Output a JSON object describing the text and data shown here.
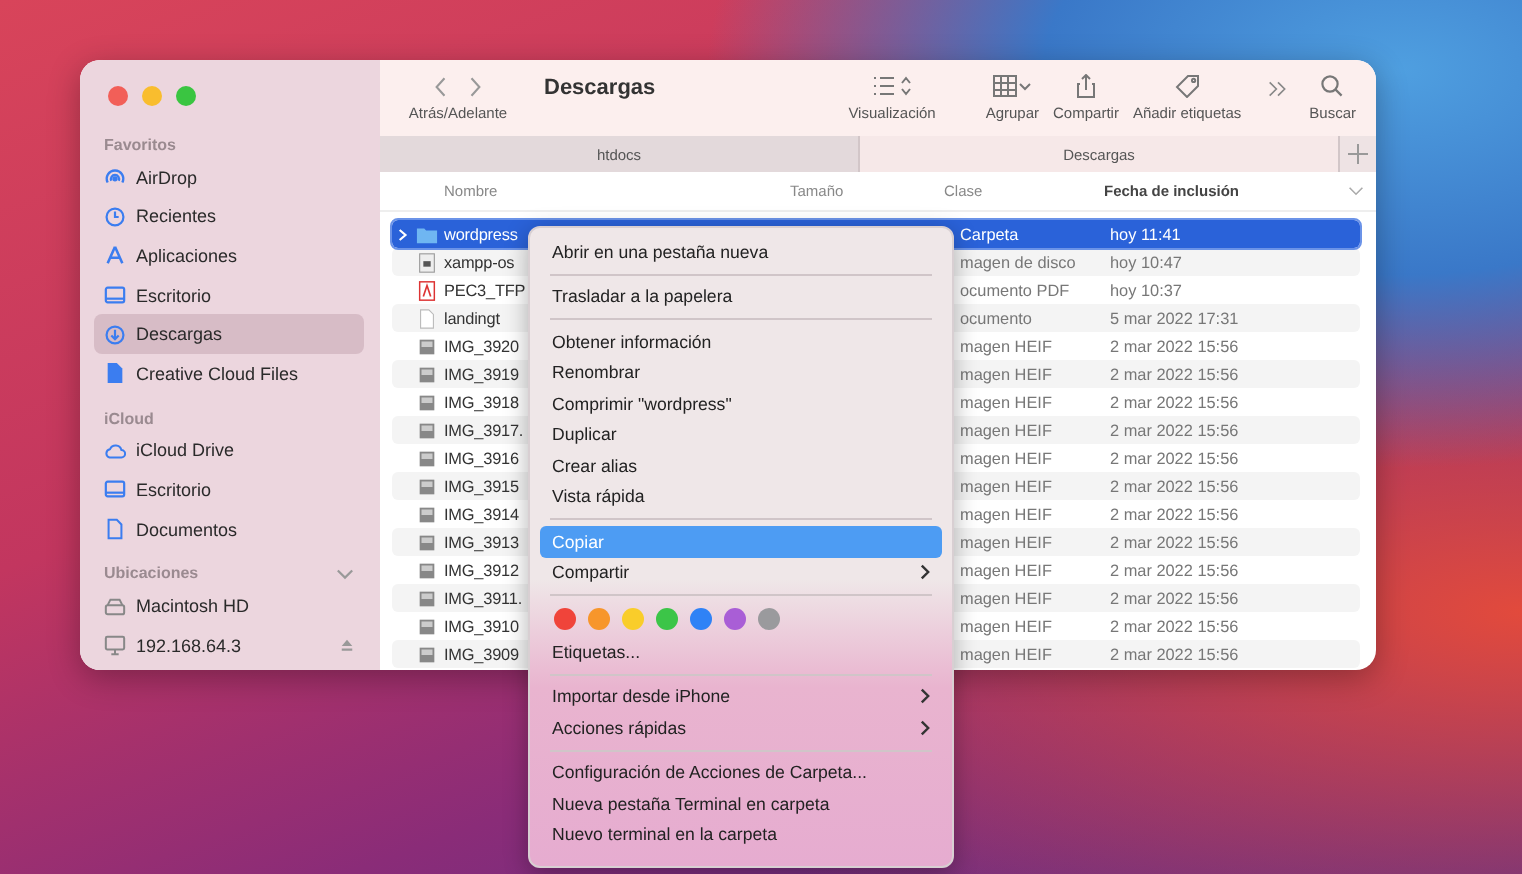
{
  "window": {
    "title": "Descargas",
    "nav_label": "Atrás/Adelante"
  },
  "toolbar": [
    {
      "kind": "view",
      "label": "Visualización"
    },
    {
      "kind": "group",
      "label": "Agrupar"
    },
    {
      "kind": "share",
      "label": "Compartir"
    },
    {
      "kind": "tag",
      "label": "Añadir etiquetas"
    },
    {
      "kind": "search",
      "label": "Buscar"
    }
  ],
  "sidebar": [
    {
      "heading": "Favoritos",
      "items": [
        {
          "label": "AirDrop",
          "selected": false
        },
        {
          "label": "Recientes",
          "selected": false
        },
        {
          "label": "Aplicaciones",
          "selected": false
        },
        {
          "label": "Escritorio",
          "selected": false
        },
        {
          "label": "Descargas",
          "selected": true
        },
        {
          "label": "Creative Cloud Files",
          "selected": false
        }
      ]
    },
    {
      "heading": "iCloud",
      "items": [
        {
          "label": "iCloud Drive",
          "selected": false
        },
        {
          "label": "Escritorio",
          "selected": false
        },
        {
          "label": "Documentos",
          "selected": false
        }
      ]
    },
    {
      "heading": "Ubicaciones",
      "items": [
        {
          "label": "Macintosh HD",
          "selected": false,
          "eject": false
        },
        {
          "label": "192.168.64.3",
          "selected": false,
          "eject": true
        }
      ]
    }
  ],
  "tabs": [
    {
      "label": "htdocs",
      "selected": false
    },
    {
      "label": "Descargas",
      "selected": true
    }
  ],
  "table": {
    "columns": [
      {
        "label": "Nombre",
        "sorted": false
      },
      {
        "label": "Tamaño",
        "sorted": false
      },
      {
        "label": "Clase",
        "sorted": false
      },
      {
        "label": "Fecha de inclusión",
        "sorted": true
      }
    ],
    "rows": [
      {
        "kind": "folder",
        "name": "wordpress",
        "class": "Carpeta",
        "date": "hoy 11:41",
        "selected": true
      },
      {
        "kind": "disk",
        "name": "xampp-os",
        "class": "magen de disco",
        "date": "hoy 10:47",
        "selected": false
      },
      {
        "kind": "pdf",
        "name": "PEC3_TFP",
        "class": "ocumento PDF",
        "date": "hoy 10:37",
        "selected": false
      },
      {
        "kind": "doc",
        "name": "landingt",
        "class": "ocumento",
        "date": "5 mar 2022 17:31",
        "selected": false
      },
      {
        "kind": "image",
        "name": "IMG_3920",
        "class": "magen HEIF",
        "date": "2 mar 2022 15:56",
        "selected": false
      },
      {
        "kind": "image",
        "name": "IMG_3919",
        "class": "magen HEIF",
        "date": "2 mar 2022 15:56",
        "selected": false
      },
      {
        "kind": "image",
        "name": "IMG_3918",
        "class": "magen HEIF",
        "date": "2 mar 2022 15:56",
        "selected": false
      },
      {
        "kind": "image",
        "name": "IMG_3917.",
        "class": "magen HEIF",
        "date": "2 mar 2022 15:56",
        "selected": false
      },
      {
        "kind": "image",
        "name": "IMG_3916",
        "class": "magen HEIF",
        "date": "2 mar 2022 15:56",
        "selected": false
      },
      {
        "kind": "image",
        "name": "IMG_3915",
        "class": "magen HEIF",
        "date": "2 mar 2022 15:56",
        "selected": false
      },
      {
        "kind": "image",
        "name": "IMG_3914",
        "class": "magen HEIF",
        "date": "2 mar 2022 15:56",
        "selected": false
      },
      {
        "kind": "image",
        "name": "IMG_3913",
        "class": "magen HEIF",
        "date": "2 mar 2022 15:56",
        "selected": false
      },
      {
        "kind": "image",
        "name": "IMG_3912",
        "class": "magen HEIF",
        "date": "2 mar 2022 15:56",
        "selected": false
      },
      {
        "kind": "image",
        "name": "IMG_3911.",
        "class": "magen HEIF",
        "date": "2 mar 2022 15:56",
        "selected": false
      },
      {
        "kind": "image",
        "name": "IMG_3910",
        "class": "magen HEIF",
        "date": "2 mar 2022 15:56",
        "selected": false
      },
      {
        "kind": "image",
        "name": "IMG_3909",
        "class": "magen HEIF",
        "date": "2 mar 2022 15:56",
        "selected": false
      }
    ]
  },
  "context_menu": [
    {
      "kind": "item",
      "label": "Abrir en una pestaña nueva",
      "selected": false,
      "submenu": false
    },
    {
      "kind": "separator"
    },
    {
      "kind": "item",
      "label": "Trasladar a la papelera",
      "selected": false,
      "submenu": false
    },
    {
      "kind": "separator"
    },
    {
      "kind": "item",
      "label": "Obtener información",
      "selected": false,
      "submenu": false
    },
    {
      "kind": "item",
      "label": "Renombrar",
      "selected": false,
      "submenu": false
    },
    {
      "kind": "item",
      "label": "Comprimir \"wordpress\"",
      "selected": false,
      "submenu": false
    },
    {
      "kind": "item",
      "label": "Duplicar",
      "selected": false,
      "submenu": false
    },
    {
      "kind": "item",
      "label": "Crear alias",
      "selected": false,
      "submenu": false
    },
    {
      "kind": "item",
      "label": "Vista rápida",
      "selected": false,
      "submenu": false
    },
    {
      "kind": "separator"
    },
    {
      "kind": "item",
      "label": "Copiar",
      "selected": true,
      "submenu": false
    },
    {
      "kind": "item",
      "label": "Compartir",
      "selected": false,
      "submenu": true
    },
    {
      "kind": "separator"
    },
    {
      "kind": "colors",
      "colors": [
        {
          "color": "#f0443a"
        },
        {
          "color": "#f7962b"
        },
        {
          "color": "#f9cd2a"
        },
        {
          "color": "#3cc548"
        },
        {
          "color": "#2f82f6"
        },
        {
          "color": "#a95ed6"
        },
        {
          "color": "#9a9a9d"
        }
      ]
    },
    {
      "kind": "item",
      "label": "Etiquetas...",
      "selected": false,
      "submenu": false
    },
    {
      "kind": "separator"
    },
    {
      "kind": "item",
      "label": "Importar desde iPhone",
      "selected": false,
      "submenu": true
    },
    {
      "kind": "item",
      "label": "Acciones rápidas",
      "selected": false,
      "submenu": true
    },
    {
      "kind": "separator"
    },
    {
      "kind": "item",
      "label": "Configuración de Acciones de Carpeta...",
      "selected": false,
      "submenu": false
    },
    {
      "kind": "item",
      "label": "Nueva pestaña Terminal en carpeta",
      "selected": false,
      "submenu": false
    },
    {
      "kind": "item",
      "label": "Nuevo terminal en la carpeta",
      "selected": false,
      "submenu": false
    }
  ]
}
